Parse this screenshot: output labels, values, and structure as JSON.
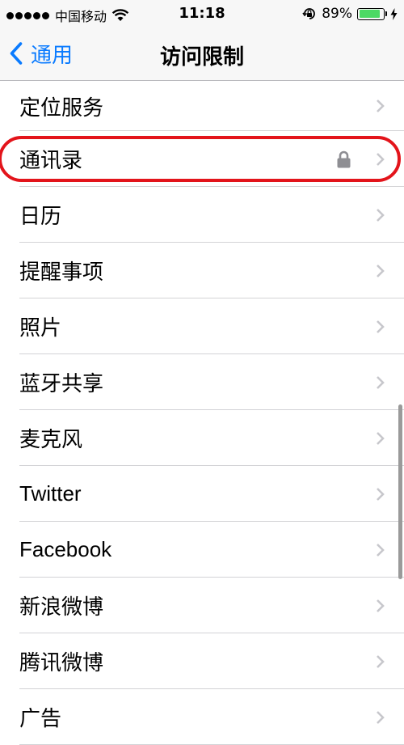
{
  "status_bar": {
    "carrier": "中国移动",
    "time": "11:18",
    "battery_percent": "89%",
    "battery_level": 0.89,
    "battery_color": "#4cd964"
  },
  "nav": {
    "back_label": "通用",
    "title": "访问限制",
    "accent_color": "#0a7bff"
  },
  "list": {
    "items": [
      {
        "label": "定位服务"
      },
      {
        "label": "通讯录",
        "locked": true,
        "highlighted": true
      },
      {
        "label": "日历"
      },
      {
        "label": "提醒事项"
      },
      {
        "label": "照片"
      },
      {
        "label": "蓝牙共享"
      },
      {
        "label": "麦克风"
      },
      {
        "label": "Twitter"
      },
      {
        "label": "Facebook"
      },
      {
        "label": "新浪微博"
      },
      {
        "label": "腾讯微博"
      },
      {
        "label": "广告"
      }
    ]
  },
  "icons": [
    "signal-dots-icon",
    "wifi-icon",
    "rotation-lock-icon",
    "battery-icon",
    "charging-bolt-icon",
    "back-chevron-icon",
    "chevron-right-icon",
    "lock-icon"
  ]
}
